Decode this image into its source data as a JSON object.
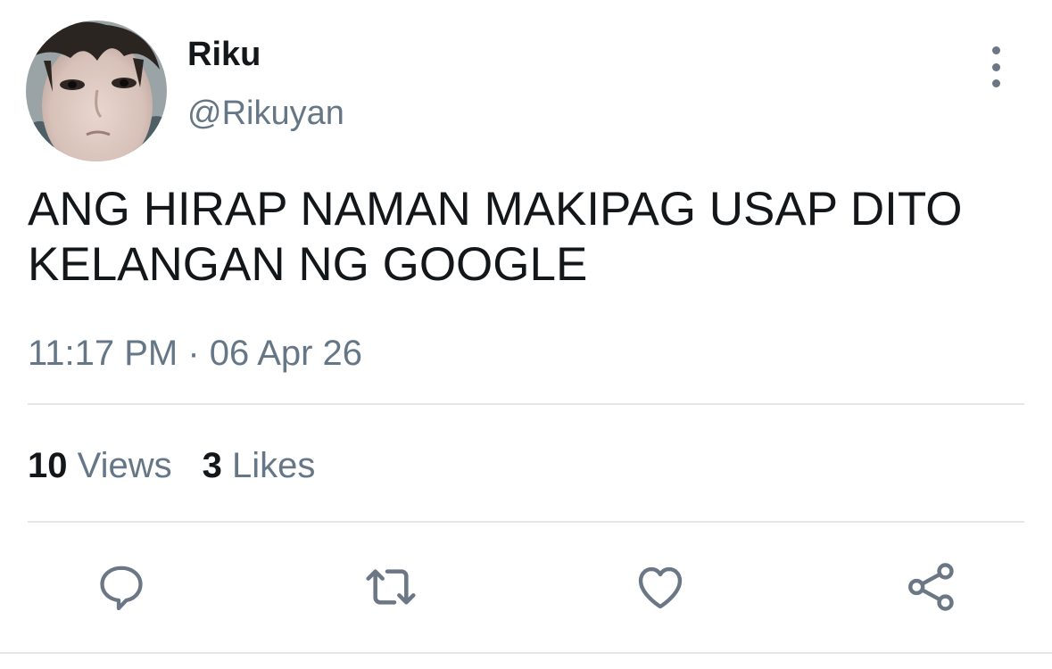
{
  "user": {
    "display_name": "Riku",
    "handle": "@Rikuyan"
  },
  "tweet": {
    "text_lines": [
      "ANG HIRAP NAMAN MAKIPAG USAP DITO",
      "KELANGAN NG GOOGLE"
    ],
    "timestamp": "11:17 PM · 06 Apr 26"
  },
  "stats": {
    "views_count": "10",
    "views_label": "Views",
    "likes_count": "3",
    "likes_label": "Likes"
  },
  "icons": {
    "more": "more-vertical-icon",
    "reply": "reply-bubble-icon",
    "retweet": "retweet-icon",
    "like": "heart-icon",
    "share": "share-icon"
  },
  "colors": {
    "text_primary": "#14171a",
    "text_secondary": "#657786",
    "icon": "#6b7785",
    "divider": "#e3e7ea"
  }
}
